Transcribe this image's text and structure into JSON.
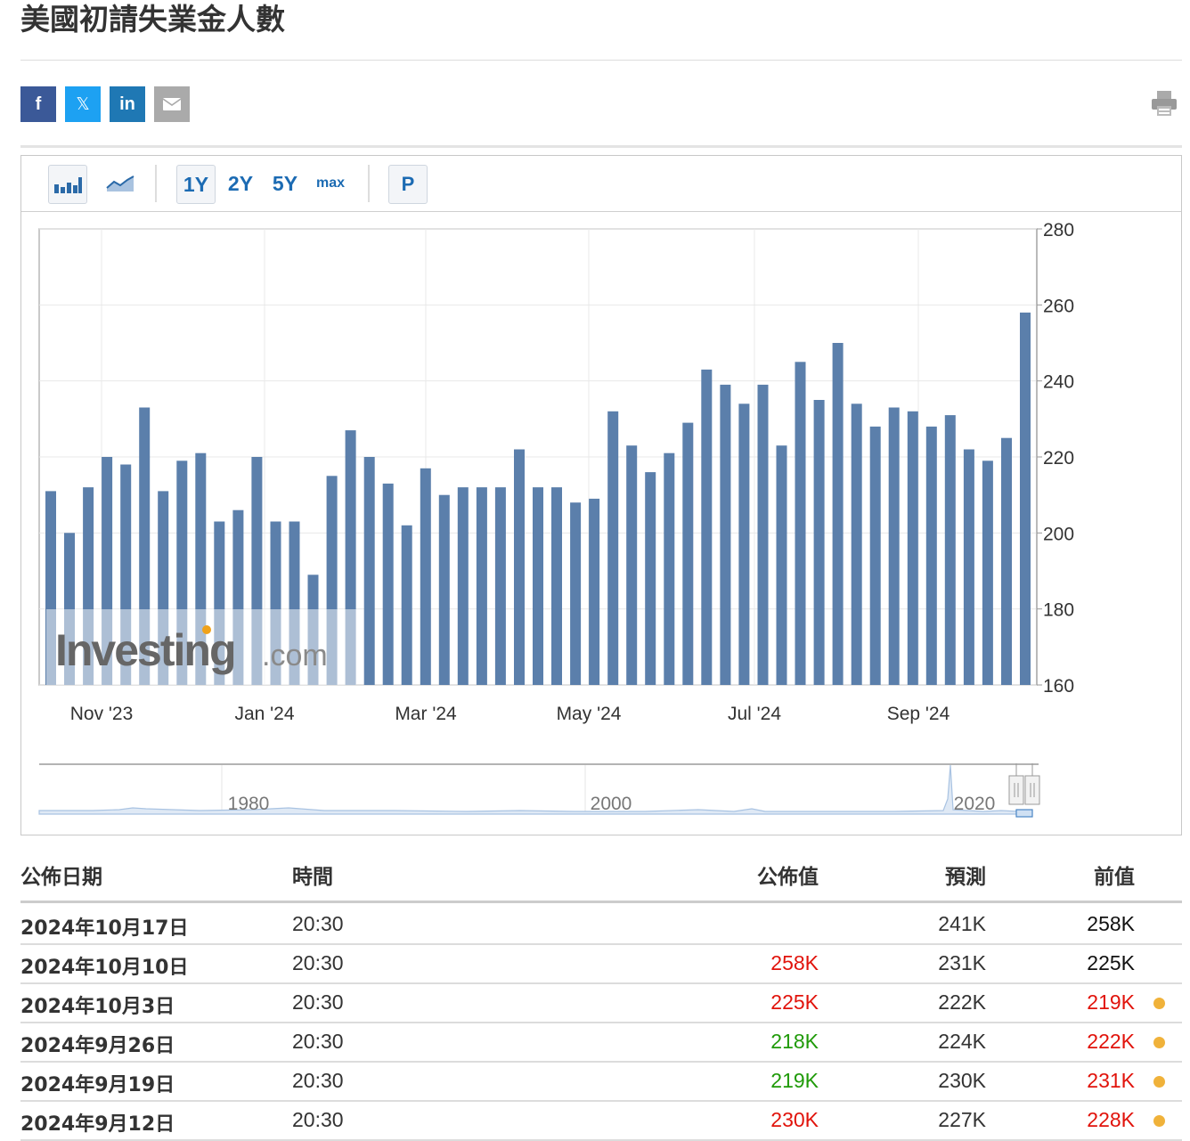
{
  "page": {
    "title": "美國初請失業金人數"
  },
  "share": {
    "facebook": "f",
    "twitter": "𝕏",
    "linkedin": "in",
    "email_icon": "envelope-icon",
    "print_icon": "printer-icon"
  },
  "toolbar": {
    "bar_icon": "bar-chart-icon",
    "line_icon": "line-chart-icon",
    "ranges": [
      "1Y",
      "2Y",
      "5Y",
      "max"
    ],
    "selected_range": "1Y",
    "p_label": "P"
  },
  "chart_data": {
    "type": "bar",
    "x_ticks": [
      "Nov '23",
      "Jan '24",
      "Mar '24",
      "May '24",
      "Jul '24",
      "Sep '24"
    ],
    "y_ticks": [
      280,
      260,
      240,
      220,
      200,
      180,
      160
    ],
    "ylim": [
      160,
      280
    ],
    "grid": true,
    "watermark": "Investing.com",
    "values": [
      211,
      200,
      212,
      220,
      218,
      233,
      211,
      219,
      221,
      203,
      206,
      220,
      203,
      203,
      189,
      215,
      227,
      220,
      213,
      202,
      217,
      210,
      212,
      212,
      212,
      222,
      212,
      212,
      208,
      209,
      232,
      223,
      216,
      221,
      229,
      243,
      239,
      234,
      239,
      223,
      245,
      235,
      250,
      234,
      228,
      233,
      232,
      228,
      231,
      222,
      219,
      225,
      258
    ],
    "series_color": "#5b7fab",
    "navigator": {
      "labels": [
        "1980",
        "2000",
        "2020"
      ]
    }
  },
  "table": {
    "headers": {
      "date": "公佈日期",
      "time": "時間",
      "actual": "公佈值",
      "forecast": "預測",
      "previous": "前值"
    },
    "rows": [
      {
        "date": "2024年10月17日",
        "time": "20:30",
        "actual": "",
        "actual_color": "black",
        "forecast": "241K",
        "previous": "258K",
        "previous_color": "black",
        "revised": false
      },
      {
        "date": "2024年10月10日",
        "time": "20:30",
        "actual": "258K",
        "actual_color": "red",
        "forecast": "231K",
        "previous": "225K",
        "previous_color": "black",
        "revised": false
      },
      {
        "date": "2024年10月3日",
        "time": "20:30",
        "actual": "225K",
        "actual_color": "red",
        "forecast": "222K",
        "previous": "219K",
        "previous_color": "red",
        "revised": true
      },
      {
        "date": "2024年9月26日",
        "time": "20:30",
        "actual": "218K",
        "actual_color": "green",
        "forecast": "224K",
        "previous": "222K",
        "previous_color": "red",
        "revised": true
      },
      {
        "date": "2024年9月19日",
        "time": "20:30",
        "actual": "219K",
        "actual_color": "green",
        "forecast": "230K",
        "previous": "231K",
        "previous_color": "red",
        "revised": true
      },
      {
        "date": "2024年9月12日",
        "time": "20:30",
        "actual": "230K",
        "actual_color": "red",
        "forecast": "227K",
        "previous": "228K",
        "previous_color": "red",
        "revised": true
      }
    ]
  }
}
